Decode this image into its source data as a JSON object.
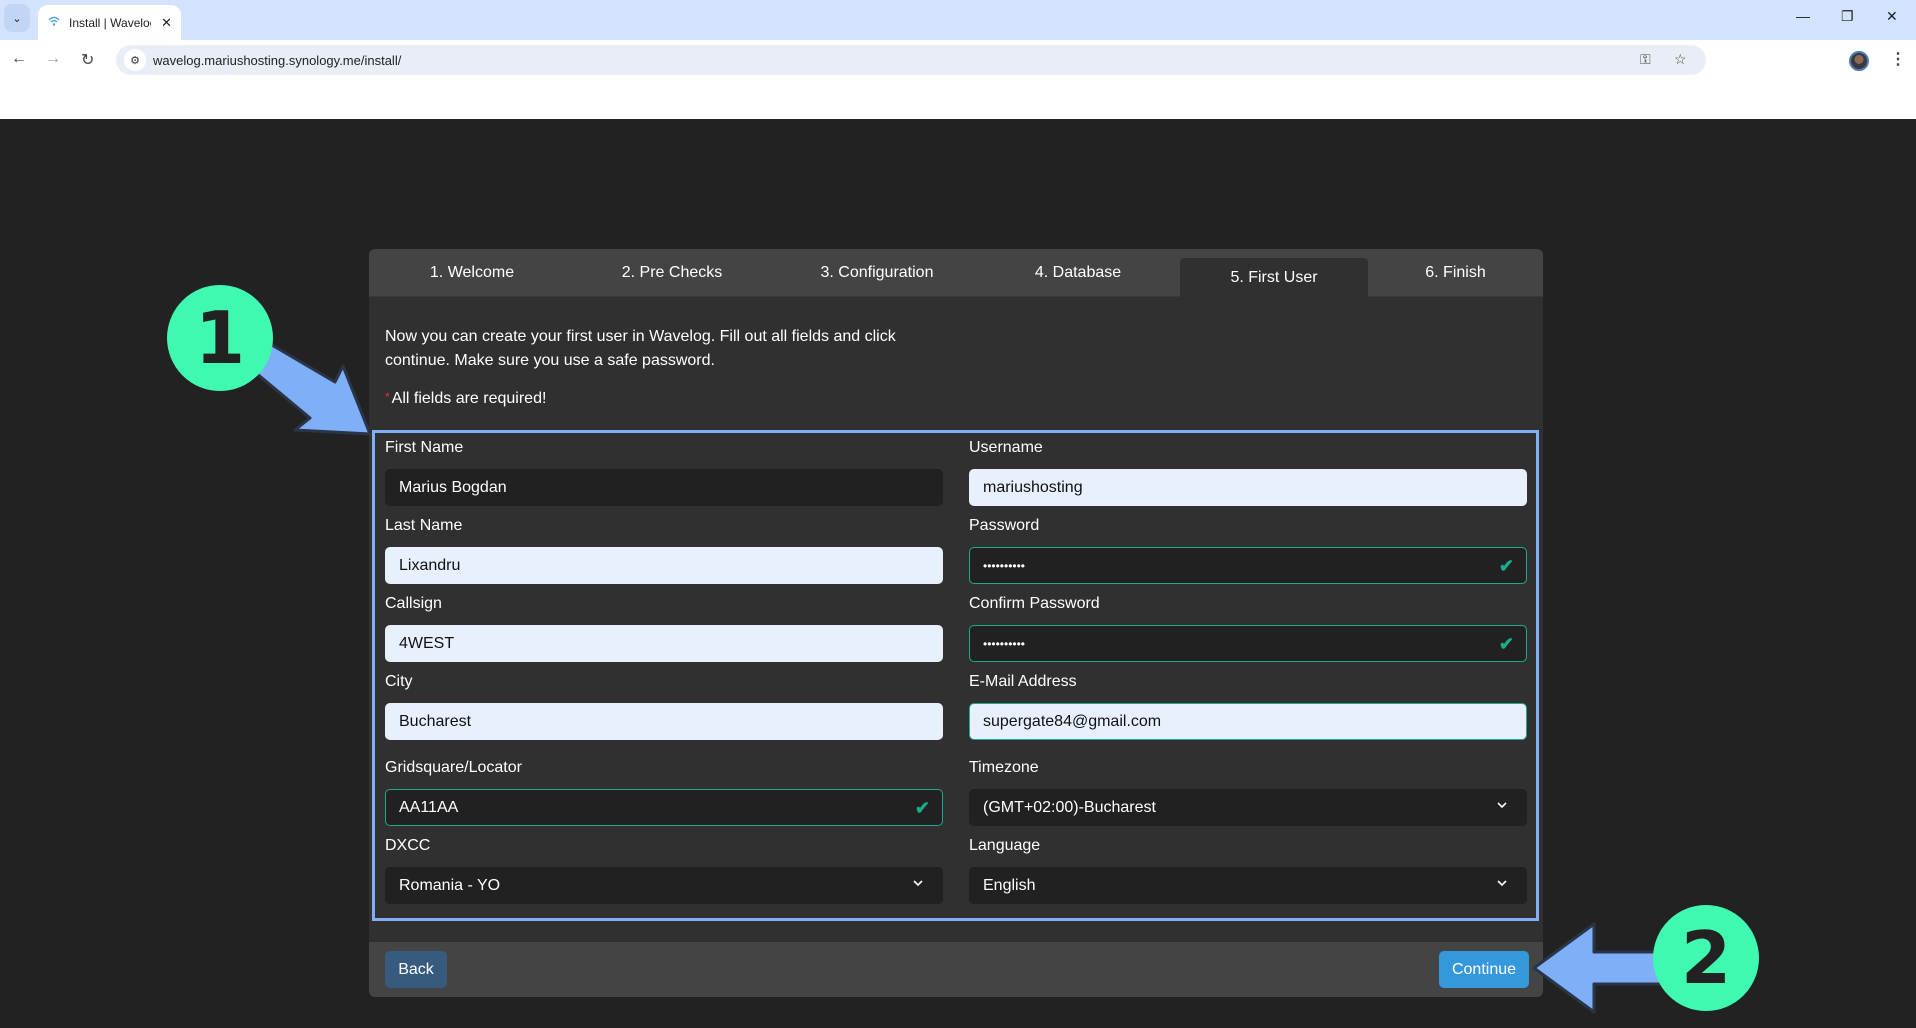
{
  "browser": {
    "tab_title": "Install | Wavelog",
    "url": "wavelog.mariushosting.synology.me/install/",
    "icons": {
      "tab_search": "chevron-down-icon",
      "favicon": "wifi-icon",
      "close": "close-icon",
      "back": "arrow-left-icon",
      "forward": "arrow-right-icon",
      "reload": "reload-icon",
      "site_info": "tune-icon",
      "password": "key-icon",
      "bookmark": "star-icon",
      "profile": "avatar-icon",
      "menu": "kebab-icon",
      "minimize": "minimize-icon",
      "restore": "restore-icon",
      "window_close": "close-icon"
    }
  },
  "installer": {
    "steps": [
      {
        "label": "1. Welcome",
        "active": false
      },
      {
        "label": "2. Pre Checks",
        "active": false
      },
      {
        "label": "3. Configuration",
        "active": false
      },
      {
        "label": "4. Database",
        "active": false
      },
      {
        "label": "5. First User",
        "active": true
      },
      {
        "label": "6. Finish",
        "active": false
      }
    ],
    "intro": "Now you can create your first user in Wavelog. Fill out all fields and click continue. Make sure you use a safe password.",
    "required_star": "*",
    "required_note": "All fields are required!",
    "form": {
      "first_name": {
        "label": "First Name",
        "value": "Marius Bogdan"
      },
      "last_name": {
        "label": "Last Name",
        "value": "Lixandru"
      },
      "callsign": {
        "label": "Callsign",
        "value": "4WEST"
      },
      "city": {
        "label": "City",
        "value": "Bucharest"
      },
      "gridsquare": {
        "label": "Gridsquare/Locator",
        "value": "AA11AA",
        "valid": true
      },
      "dxcc": {
        "label": "DXCC",
        "value": "Romania - YO"
      },
      "username": {
        "label": "Username",
        "value": "mariushosting"
      },
      "password": {
        "label": "Password",
        "value": "••••••••••",
        "valid": true
      },
      "confirm_password": {
        "label": "Confirm Password",
        "value": "••••••••••",
        "valid": true
      },
      "email": {
        "label": "E-Mail Address",
        "value": "supergate84@gmail.com"
      },
      "timezone": {
        "label": "Timezone",
        "value": "(GMT+02:00)-Bucharest"
      },
      "language": {
        "label": "Language",
        "value": "English"
      }
    },
    "buttons": {
      "back": "Back",
      "continue": "Continue"
    }
  },
  "annotations": {
    "badge_1": "1",
    "badge_2": "2",
    "colors": {
      "badge": "#40f9b0",
      "arrow": "#7fb0f7",
      "highlight": "#7fb0f7"
    }
  },
  "colors": {
    "valid": "#1aab8a",
    "back_button": "#375a7f",
    "continue_button": "#3498db",
    "required_star": "#e03131"
  }
}
